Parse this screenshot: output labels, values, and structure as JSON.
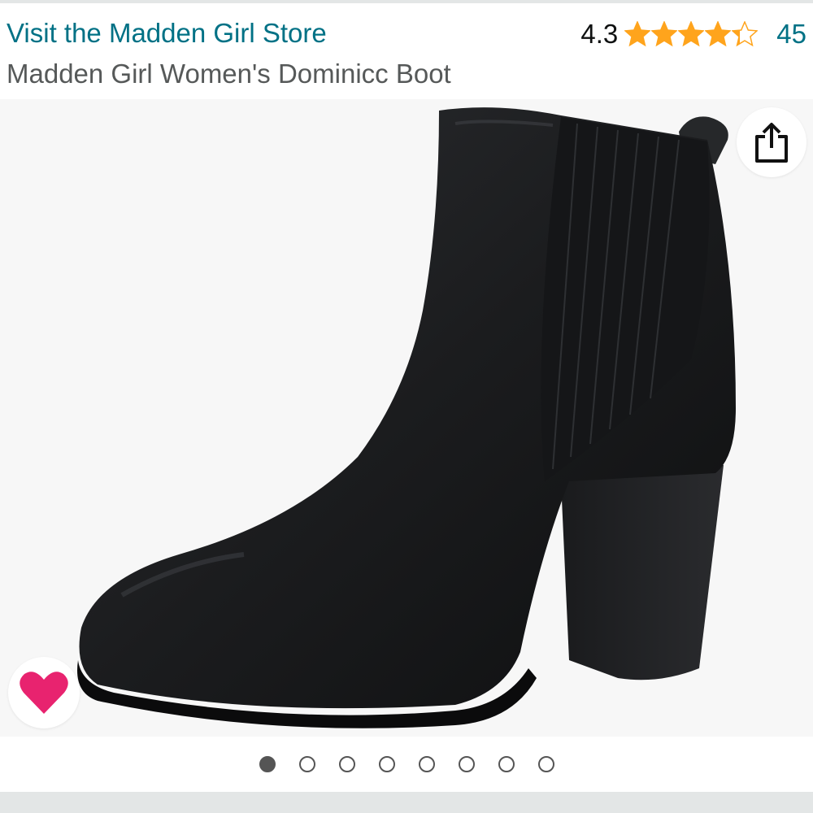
{
  "header": {
    "store_link": "Visit the Madden Girl Store",
    "product_title": "Madden Girl Women's Dominicc Boot",
    "rating_value": "4.3",
    "rating_count": "45",
    "stars": {
      "filled": 4,
      "partial": 0.3,
      "total": 5,
      "color": "#ffa41c"
    }
  },
  "gallery": {
    "image": "black-ankle-boot",
    "image_count": 8,
    "active_index": 0,
    "share_icon": "share-icon",
    "wishlist_icon": "heart-icon",
    "heart_color": "#e8236f"
  },
  "colors": {
    "link": "#007185",
    "title": "#565959",
    "star": "#ffa41c"
  }
}
